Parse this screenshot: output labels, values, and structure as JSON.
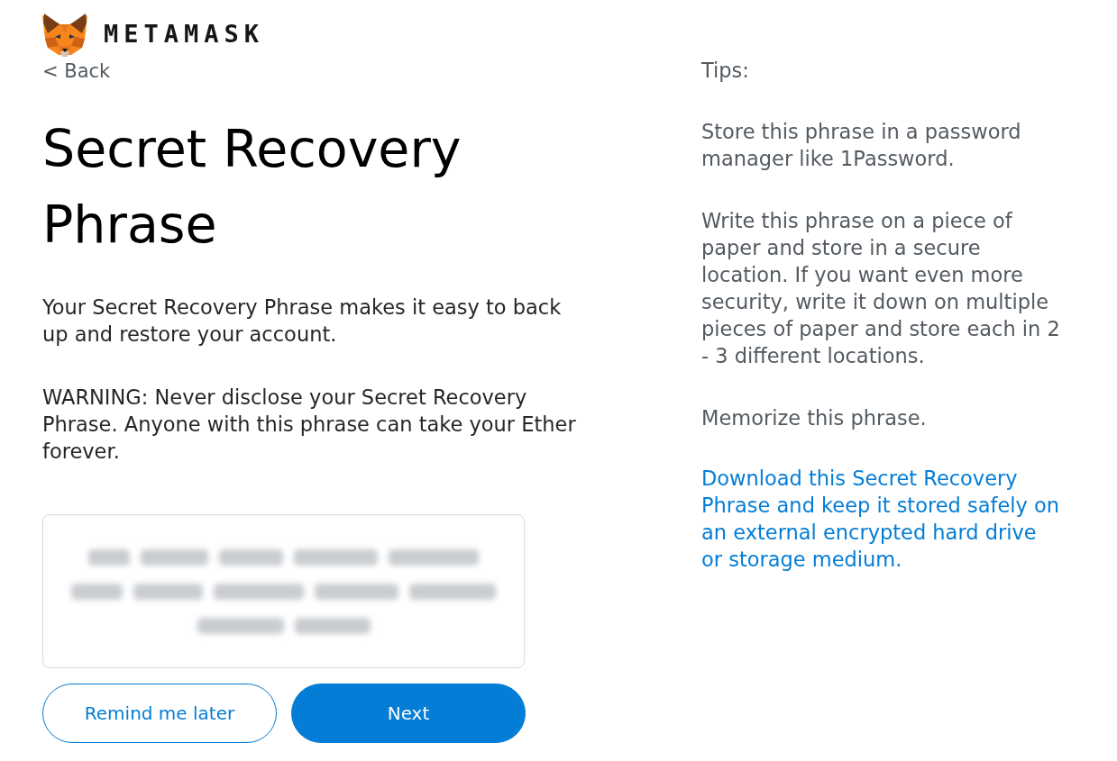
{
  "header": {
    "wordmark": "METAMASK"
  },
  "back_link": "< Back",
  "title": "Secret Recovery Phrase",
  "paragraphs": [
    "Your Secret Recovery Phrase makes it easy to back up and restore your account.",
    "WARNING: Never disclose your Secret Recovery Phrase. Anyone with this phrase can take your Ether forever."
  ],
  "secret_phrase": {
    "blurred": true
  },
  "buttons": [
    {
      "label": "Remind me later",
      "kind": "secondary"
    },
    {
      "label": "Next",
      "kind": "primary"
    }
  ],
  "tips": {
    "heading": "Tips:",
    "items": [
      {
        "kind": "text",
        "text": "Store this phrase in a password manager like 1Password."
      },
      {
        "kind": "text",
        "text": "Write this phrase on a piece of paper and store in a secure location. If you want even more security, write it down on multiple pieces of paper and store each in 2 - 3 different locations."
      },
      {
        "kind": "text",
        "text": "Memorize this phrase."
      },
      {
        "kind": "link",
        "text": "Download this Secret Recovery Phrase and keep it stored safely on an external encrypted hard drive or storage medium."
      }
    ]
  }
}
